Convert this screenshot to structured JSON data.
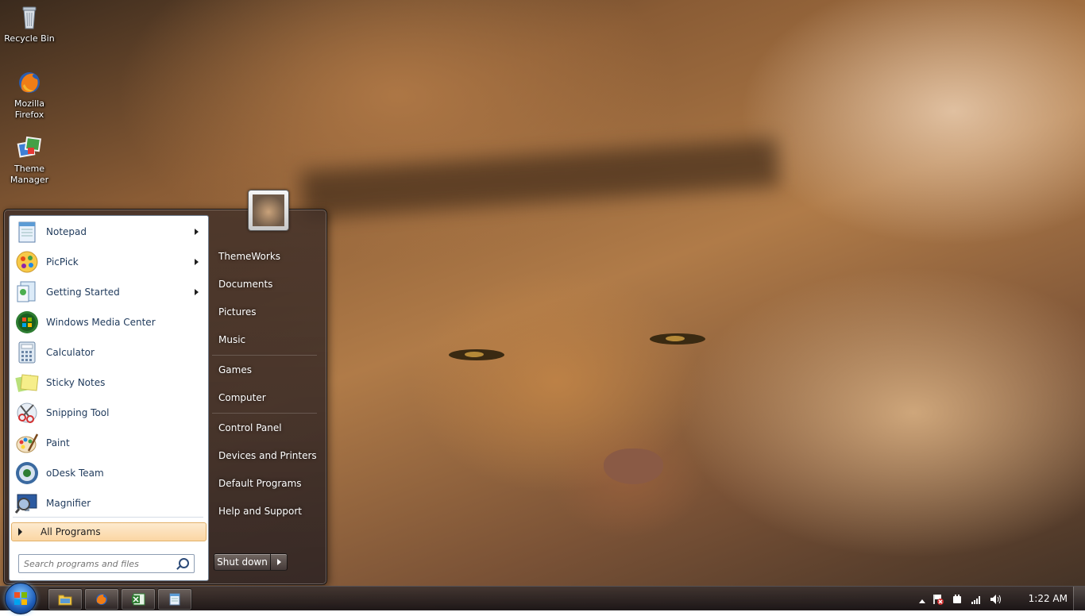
{
  "desktop": {
    "icons": [
      {
        "label": "Recycle Bin",
        "icon": "recycle-bin-icon"
      },
      {
        "label": "Mozilla Firefox",
        "icon": "firefox-icon"
      },
      {
        "label": "Theme Manager",
        "icon": "theme-manager-icon"
      }
    ]
  },
  "start_menu": {
    "pinned_programs": [
      {
        "label": "Notepad",
        "icon": "notepad-icon",
        "has_submenu": true
      },
      {
        "label": "PicPick",
        "icon": "picpick-icon",
        "has_submenu": true
      },
      {
        "label": "Getting Started",
        "icon": "getting-started-icon",
        "has_submenu": true
      },
      {
        "label": "Windows Media Center",
        "icon": "media-center-icon",
        "has_submenu": false
      },
      {
        "label": "Calculator",
        "icon": "calculator-icon",
        "has_submenu": false
      },
      {
        "label": "Sticky Notes",
        "icon": "sticky-notes-icon",
        "has_submenu": false
      },
      {
        "label": "Snipping Tool",
        "icon": "snipping-tool-icon",
        "has_submenu": false
      },
      {
        "label": "Paint",
        "icon": "paint-icon",
        "has_submenu": false
      },
      {
        "label": "oDesk Team",
        "icon": "odesk-team-icon",
        "has_submenu": false
      },
      {
        "label": "Magnifier",
        "icon": "magnifier-icon",
        "has_submenu": false
      }
    ],
    "all_programs_label": "All Programs",
    "search_placeholder": "Search programs and files",
    "right_links": [
      {
        "label": "ThemeWorks"
      },
      {
        "label": "Documents"
      },
      {
        "label": "Pictures"
      },
      {
        "label": "Music"
      },
      {
        "label": "Games"
      },
      {
        "label": "Computer"
      },
      {
        "label": "Control Panel"
      },
      {
        "label": "Devices and Printers"
      },
      {
        "label": "Default Programs"
      },
      {
        "label": "Help and Support"
      }
    ],
    "shutdown_label": "Shut down"
  },
  "taskbar": {
    "pinned": [
      {
        "icon": "windows-explorer-icon"
      },
      {
        "icon": "firefox-icon"
      },
      {
        "icon": "excel-icon"
      },
      {
        "icon": "notepad-icon"
      }
    ],
    "tray_icons": [
      "show-hidden-icons-chevron",
      "action-center-flag-icon",
      "power-plug-icon",
      "network-signal-icon",
      "volume-icon"
    ],
    "clock": "1:22 AM"
  },
  "colors": {
    "accent_orange": "#fbd6a3",
    "program_text": "#1e395b",
    "taskbar": "#2a2224"
  }
}
